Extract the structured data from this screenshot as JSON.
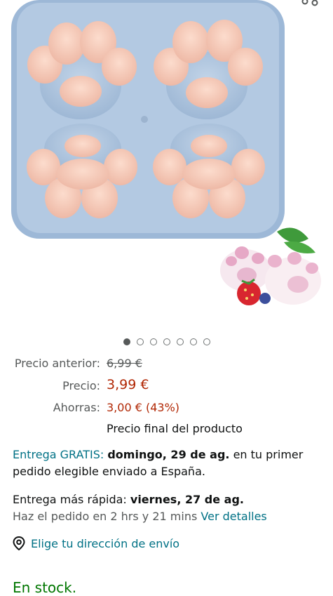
{
  "gallery": {
    "image_alt": "Molde de silicona con 4 cavidades en forma de pata de gato, con postres de muestra",
    "dot_count": 7,
    "active_dot": 0
  },
  "pricing": {
    "previous_label": "Precio anterior:",
    "previous_value": "6,99 €",
    "price_label": "Precio:",
    "price_value": "3,99 €",
    "savings_label": "Ahorras:",
    "savings_value": "3,00 € (43%)",
    "final_note": "Precio final del producto"
  },
  "delivery": {
    "free_label": "Entrega GRATIS:",
    "free_date": "domingo, 29 de ag.",
    "free_suffix": "en tu primer",
    "free_line2": "pedido elegible enviado a España.",
    "fast_label": "Entrega más rápida:",
    "fast_date": "viernes, 27 de ag.",
    "order_within": "Haz el pedido en 2 hrs y 21 mins",
    "details_link": "Ver detalles"
  },
  "address": {
    "link": "Elige tu dirección de envío",
    "icon": "location-pin-icon"
  },
  "stock": {
    "status": "En stock."
  },
  "colors": {
    "price_red": "#b12704",
    "link_teal": "#007185",
    "stock_green": "#007600",
    "mold_blue": "#a9c2de",
    "paw_pink": "#f6cfc0"
  }
}
